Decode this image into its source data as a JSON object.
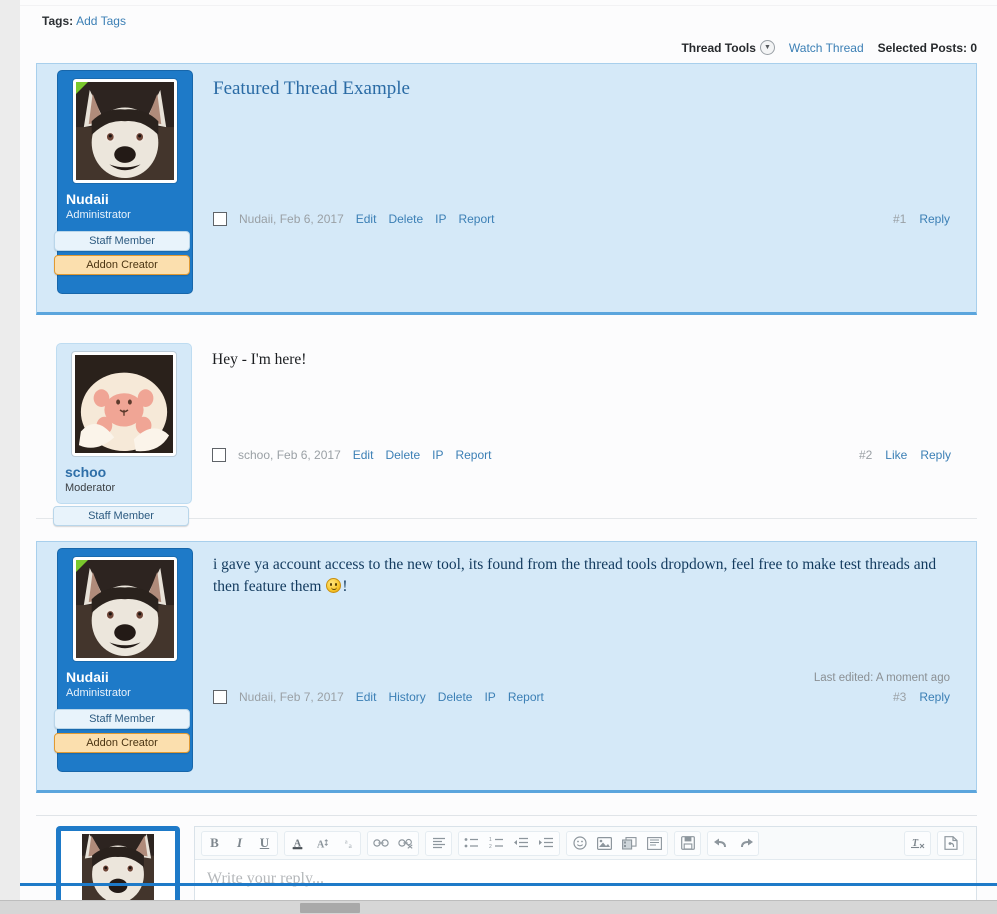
{
  "tags": {
    "label": "Tags:",
    "add_link": "Add Tags"
  },
  "thread_tools_bar": {
    "thread_tools": "Thread Tools",
    "watch_thread": "Watch Thread",
    "selected_posts_label": "Selected Posts: 0"
  },
  "posts": [
    {
      "id": "post-1",
      "featured": true,
      "user": {
        "name": "Nudaii",
        "title": "Administrator",
        "avatar_alt": "husky-dog-avatar",
        "online": true,
        "badges": [
          "Staff Member",
          "Addon Creator"
        ]
      },
      "title": "Featured Thread Example",
      "body": "",
      "meta": {
        "author_date": "Nudaii, Feb 6, 2017",
        "links": [
          "Edit",
          "Delete",
          "IP",
          "Report"
        ],
        "number": "#1",
        "right_links": [
          "Reply"
        ],
        "last_edited": ""
      }
    },
    {
      "id": "post-2",
      "featured": false,
      "user": {
        "name": "schoo",
        "title": "Moderator",
        "avatar_alt": "cat-paw-avatar",
        "online": false,
        "badges": [
          "Staff Member"
        ]
      },
      "title": "",
      "body": "Hey - I'm here!",
      "meta": {
        "author_date": "schoo, Feb 6, 2017",
        "links": [
          "Edit",
          "Delete",
          "IP",
          "Report"
        ],
        "number": "#2",
        "right_links": [
          "Like",
          "Reply"
        ],
        "last_edited": ""
      }
    },
    {
      "id": "post-3",
      "featured": true,
      "user": {
        "name": "Nudaii",
        "title": "Administrator",
        "avatar_alt": "husky-dog-avatar",
        "online": true,
        "badges": [
          "Staff Member",
          "Addon Creator"
        ]
      },
      "title": "",
      "body_part1": "i gave ya account access to the new tool, its found from the thread tools dropdown, feel free to make test threads and then feature them ",
      "body_part2": "!",
      "meta": {
        "author_date": "Nudaii, Feb 7, 2017",
        "links": [
          "Edit",
          "History",
          "Delete",
          "IP",
          "Report"
        ],
        "number": "#3",
        "right_links": [
          "Reply"
        ],
        "last_edited": "Last edited: A moment ago"
      }
    }
  ],
  "editor": {
    "avatar_alt": "husky-dog-avatar",
    "placeholder": "Write your reply...",
    "toolbar_groups": [
      {
        "name": "text-style",
        "buttons": [
          "bold",
          "italic",
          "underline"
        ]
      },
      {
        "name": "font",
        "buttons": [
          "text-color",
          "font-size",
          "remove-format"
        ]
      },
      {
        "name": "link",
        "buttons": [
          "insert-link",
          "unlink"
        ]
      },
      {
        "name": "align",
        "buttons": [
          "align"
        ]
      },
      {
        "name": "list",
        "buttons": [
          "bullet-list",
          "numbered-list",
          "outdent",
          "indent"
        ]
      },
      {
        "name": "insert",
        "buttons": [
          "smilie",
          "image",
          "media",
          "insert-quote"
        ]
      },
      {
        "name": "draft",
        "buttons": [
          "save-draft"
        ]
      },
      {
        "name": "history",
        "buttons": [
          "undo",
          "redo"
        ]
      },
      {
        "name": "tools",
        "buttons": [
          "remove-formatting"
        ]
      },
      {
        "name": "source",
        "buttons": [
          "toggle-bbcode"
        ]
      }
    ]
  },
  "colors": {
    "featured_bg": "#d5e9f8",
    "admin_card": "#1e7ac8",
    "mod_card": "#d5e9f8",
    "link": "#3b7fb5",
    "badge_addon": "#fbdfae",
    "online": "#7ac82d"
  }
}
